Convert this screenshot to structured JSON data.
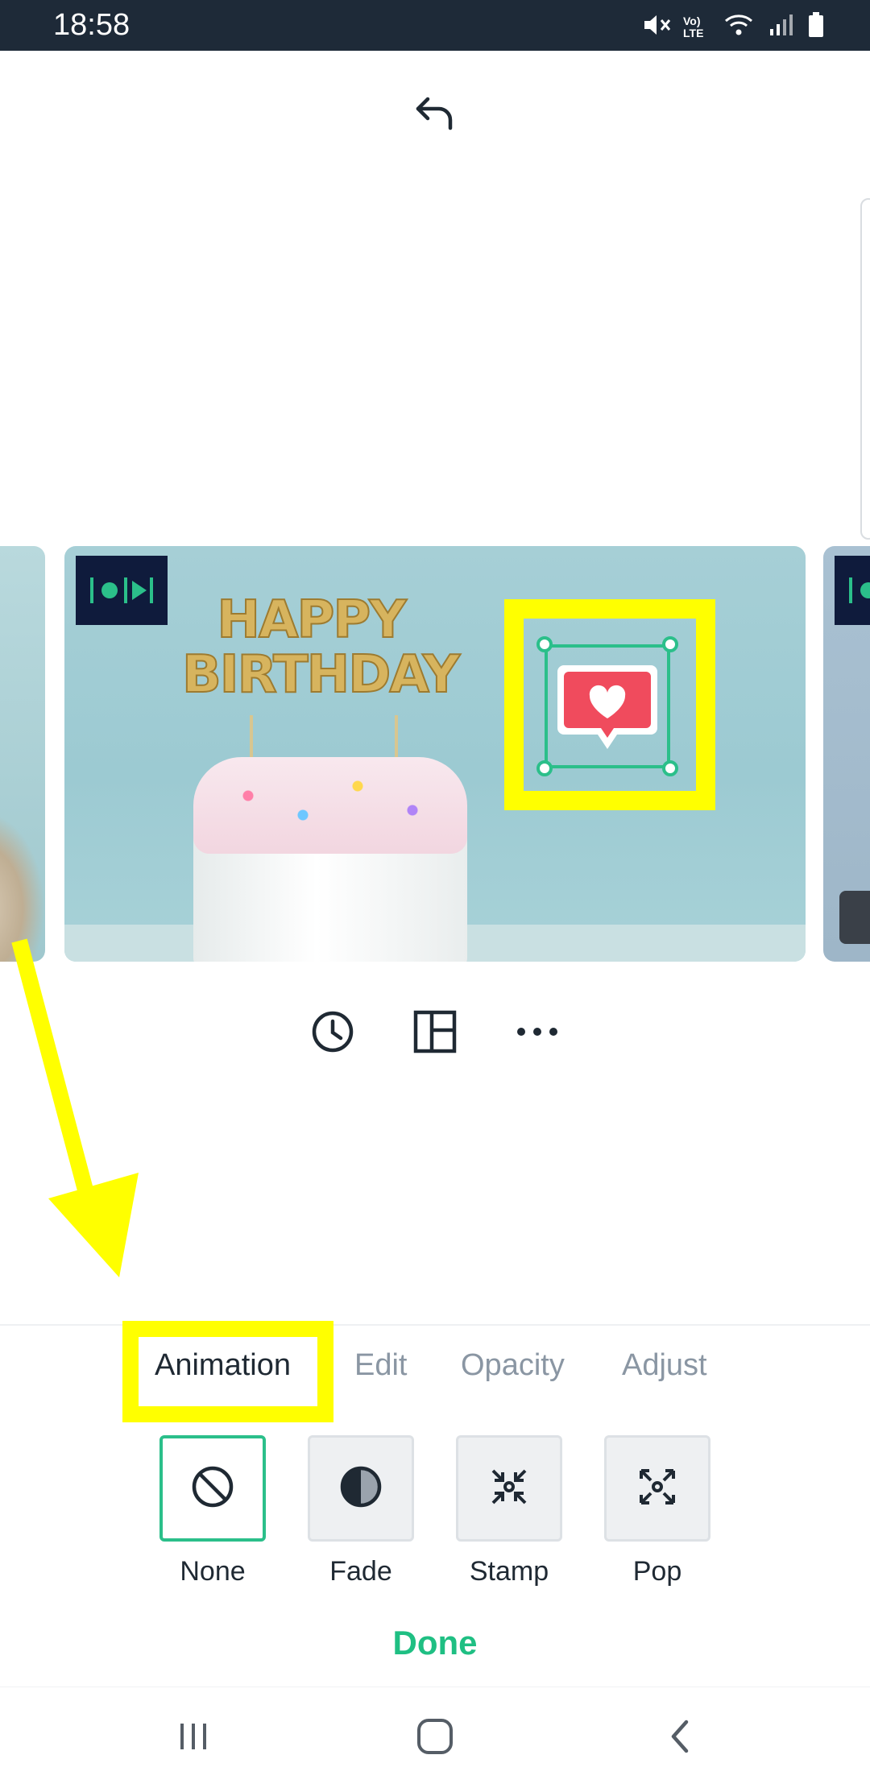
{
  "status_bar": {
    "time": "18:58",
    "icons": [
      "mute-icon",
      "volte-icon",
      "wifi-icon",
      "signal-icon",
      "battery-icon"
    ],
    "volte_text": "Vo) LTE"
  },
  "header": {
    "undo_icon": "undo-icon"
  },
  "slides": {
    "main_image_text": "HAPPY BIRTHDAY",
    "badge_icon": "animation-badge-icon",
    "sticker_icon": "heart-speech-bubble-sticker"
  },
  "slide_tools": [
    "clock-icon",
    "layout-icon",
    "more-icon"
  ],
  "bottom_sheet": {
    "tabs": [
      {
        "label": "Animation",
        "active": true
      },
      {
        "label": "Edit",
        "active": false
      },
      {
        "label": "Opacity",
        "active": false
      },
      {
        "label": "Adjust",
        "active": false
      }
    ],
    "options": [
      {
        "label": "None",
        "icon": "none-icon",
        "selected": true
      },
      {
        "label": "Fade",
        "icon": "fade-icon",
        "selected": false
      },
      {
        "label": "Stamp",
        "icon": "stamp-icon",
        "selected": false
      },
      {
        "label": "Pop",
        "icon": "pop-icon",
        "selected": false
      }
    ],
    "done_label": "Done"
  },
  "nav_bar": [
    "recents-icon",
    "home-icon",
    "back-icon"
  ],
  "colors": {
    "accent": "#2bbf8a",
    "done": "#1fbf83",
    "highlight": "#ffff00",
    "status_bar": "#1e2a38"
  }
}
